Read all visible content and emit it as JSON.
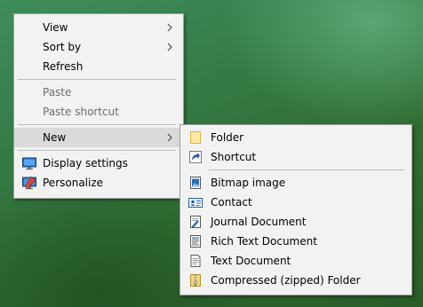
{
  "context_menu": {
    "items": {
      "view": "View",
      "sort_by": "Sort by",
      "refresh": "Refresh",
      "paste": "Paste",
      "paste_shortcut": "Paste shortcut",
      "new": "New",
      "display_settings": "Display settings",
      "personalize": "Personalize"
    }
  },
  "new_submenu": {
    "items": {
      "folder": "Folder",
      "shortcut": "Shortcut",
      "bitmap_image": "Bitmap image",
      "contact": "Contact",
      "journal_document": "Journal Document",
      "rich_text_document": "Rich Text Document",
      "text_document": "Text Document",
      "compressed_folder": "Compressed (zipped) Folder"
    }
  },
  "icons": {
    "display_settings": "display-icon",
    "personalize": "personalize-icon",
    "folder": "folder-icon",
    "shortcut": "shortcut-icon",
    "bitmap_image": "bitmap-icon",
    "contact": "contact-card-icon",
    "journal_document": "journal-icon",
    "rich_text_document": "rich-text-icon",
    "text_document": "text-document-icon",
    "compressed_folder": "zip-folder-icon"
  },
  "colors": {
    "menu_background": "#f2f2f2",
    "hover_highlight": "#dadada",
    "disabled_text": "#6d6d6d",
    "desktop_green": "#357a45"
  }
}
